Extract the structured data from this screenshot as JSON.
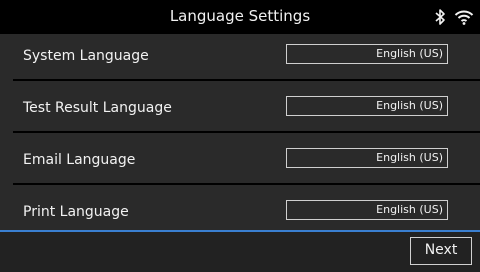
{
  "header": {
    "title": "Language Settings",
    "status_icons": [
      "bluetooth-icon",
      "wifi-icon"
    ]
  },
  "settings": [
    {
      "label": "System Language",
      "value": "English (US)"
    },
    {
      "label": "Test Result Language",
      "value": "English (US)"
    },
    {
      "label": "Email Language",
      "value": "English (US)"
    },
    {
      "label": "Print Language",
      "value": "English (US)"
    }
  ],
  "footer": {
    "next_label": "Next"
  },
  "colors": {
    "background": "#000000",
    "list_background": "#2a2a2a",
    "accent_line": "#3a7fd0",
    "text": "#f2f2f2"
  }
}
